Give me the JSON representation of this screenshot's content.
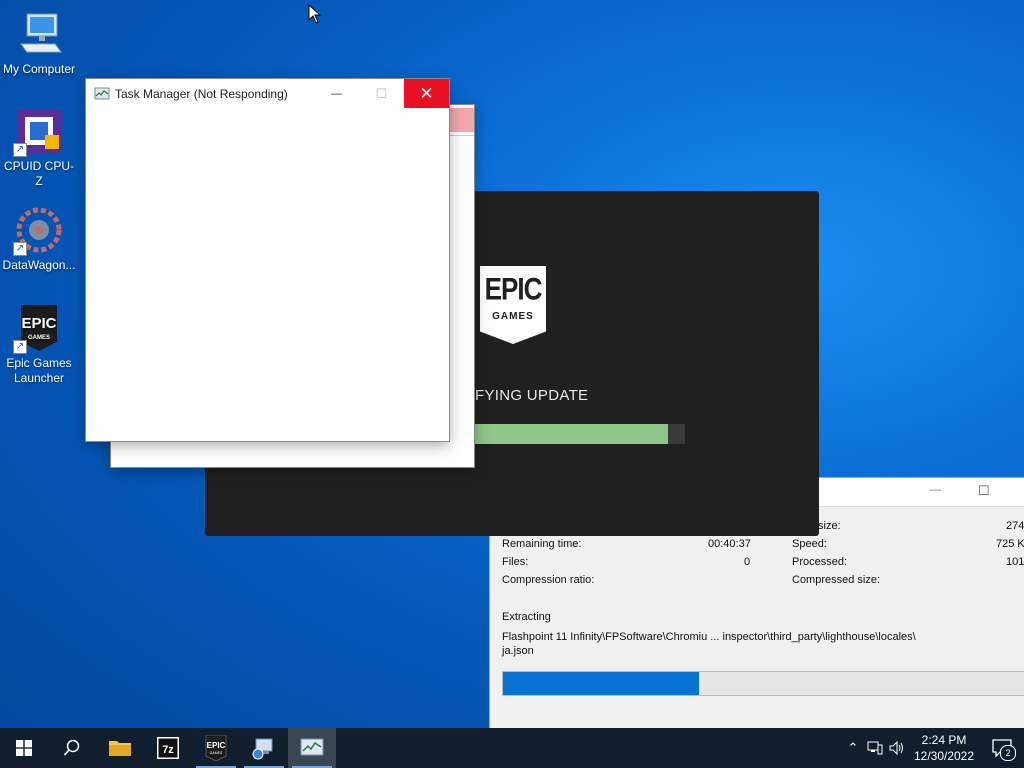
{
  "desktop": {
    "icons": [
      {
        "label": "My Computer",
        "icon": "computer-icon"
      },
      {
        "label": "CPUID CPU-Z",
        "icon": "cpuz-icon"
      },
      {
        "label": "DataWagon...",
        "icon": "datawagon-icon"
      },
      {
        "label": "Epic Games\nLauncher",
        "icon": "epic-games-icon"
      }
    ]
  },
  "task_manager": {
    "title": "Task Manager (Not Responding)",
    "minimize": "—",
    "maximize": "☐",
    "close": "✕"
  },
  "epic_launcher": {
    "logo_line1": "EPIC",
    "logo_line2": "GAMES",
    "status": "FYING UPDATE",
    "progress": 0.92,
    "accent": "#8fc68a"
  },
  "extract_dialog": {
    "minimize": "—",
    "maximize": "☐",
    "size_label": "size:",
    "size_value": "274",
    "remaining_label": "Remaining time:",
    "remaining_value": "00:40:37",
    "speed_label": "Speed:",
    "speed_value": "725 K",
    "files_label": "Files:",
    "files_value": "0",
    "processed_label": "Processed:",
    "processed_value": "101",
    "compression_label": "Compression ratio:",
    "compressed_label": "Compressed size:",
    "action": "Extracting",
    "path_line1": "Flashpoint 11 Infinity\\FPSoftware\\Chromiu ... inspector\\third_party\\lighthouse\\locales\\",
    "path_line2": "ja.json",
    "progress": 0.37,
    "accent": "#0672d1"
  },
  "taskbar": {
    "items": [
      "start-icon",
      "search-icon",
      "file-explorer-icon",
      "7zip-icon",
      "epic-games-icon",
      "network-tool-icon",
      "task-manager-icon"
    ],
    "time": "2:24 PM",
    "date": "12/30/2022",
    "notifications": "2"
  }
}
